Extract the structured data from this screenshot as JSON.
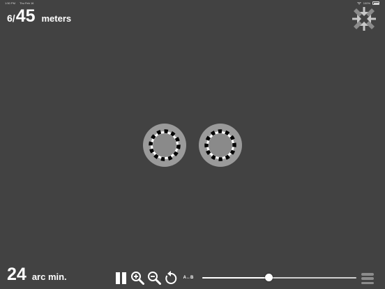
{
  "status_bar": {
    "time": "1:50 PM",
    "date": "Thu Feb 16",
    "battery": "100%",
    "icons": [
      "wifi-icon",
      "battery-icon"
    ]
  },
  "distance": {
    "numerator": "6",
    "separator": "/",
    "denominator": "45",
    "unit": "meters"
  },
  "fullscreen_button": {
    "icon": "collapse-arrows-icon"
  },
  "acuity": {
    "value": "24",
    "unit": "arc min."
  },
  "controls": {
    "pause_icon": "pause-icon",
    "zoom_in_icon": "zoom-in-icon",
    "zoom_out_icon": "zoom-out-icon",
    "rotate_icon": "rotate-icon",
    "ab_label": "A↔B",
    "slider_value": 0.43,
    "menu_icon": "hamburger-menu-icon"
  },
  "colors": {
    "background": "#424242",
    "target_disc": "#9a9a9a",
    "target_inner": "#8a8a8a",
    "text": "#ffffff",
    "fullscreen_icon": "#c8c8c8",
    "menu_icon": "#8c8c8c"
  }
}
